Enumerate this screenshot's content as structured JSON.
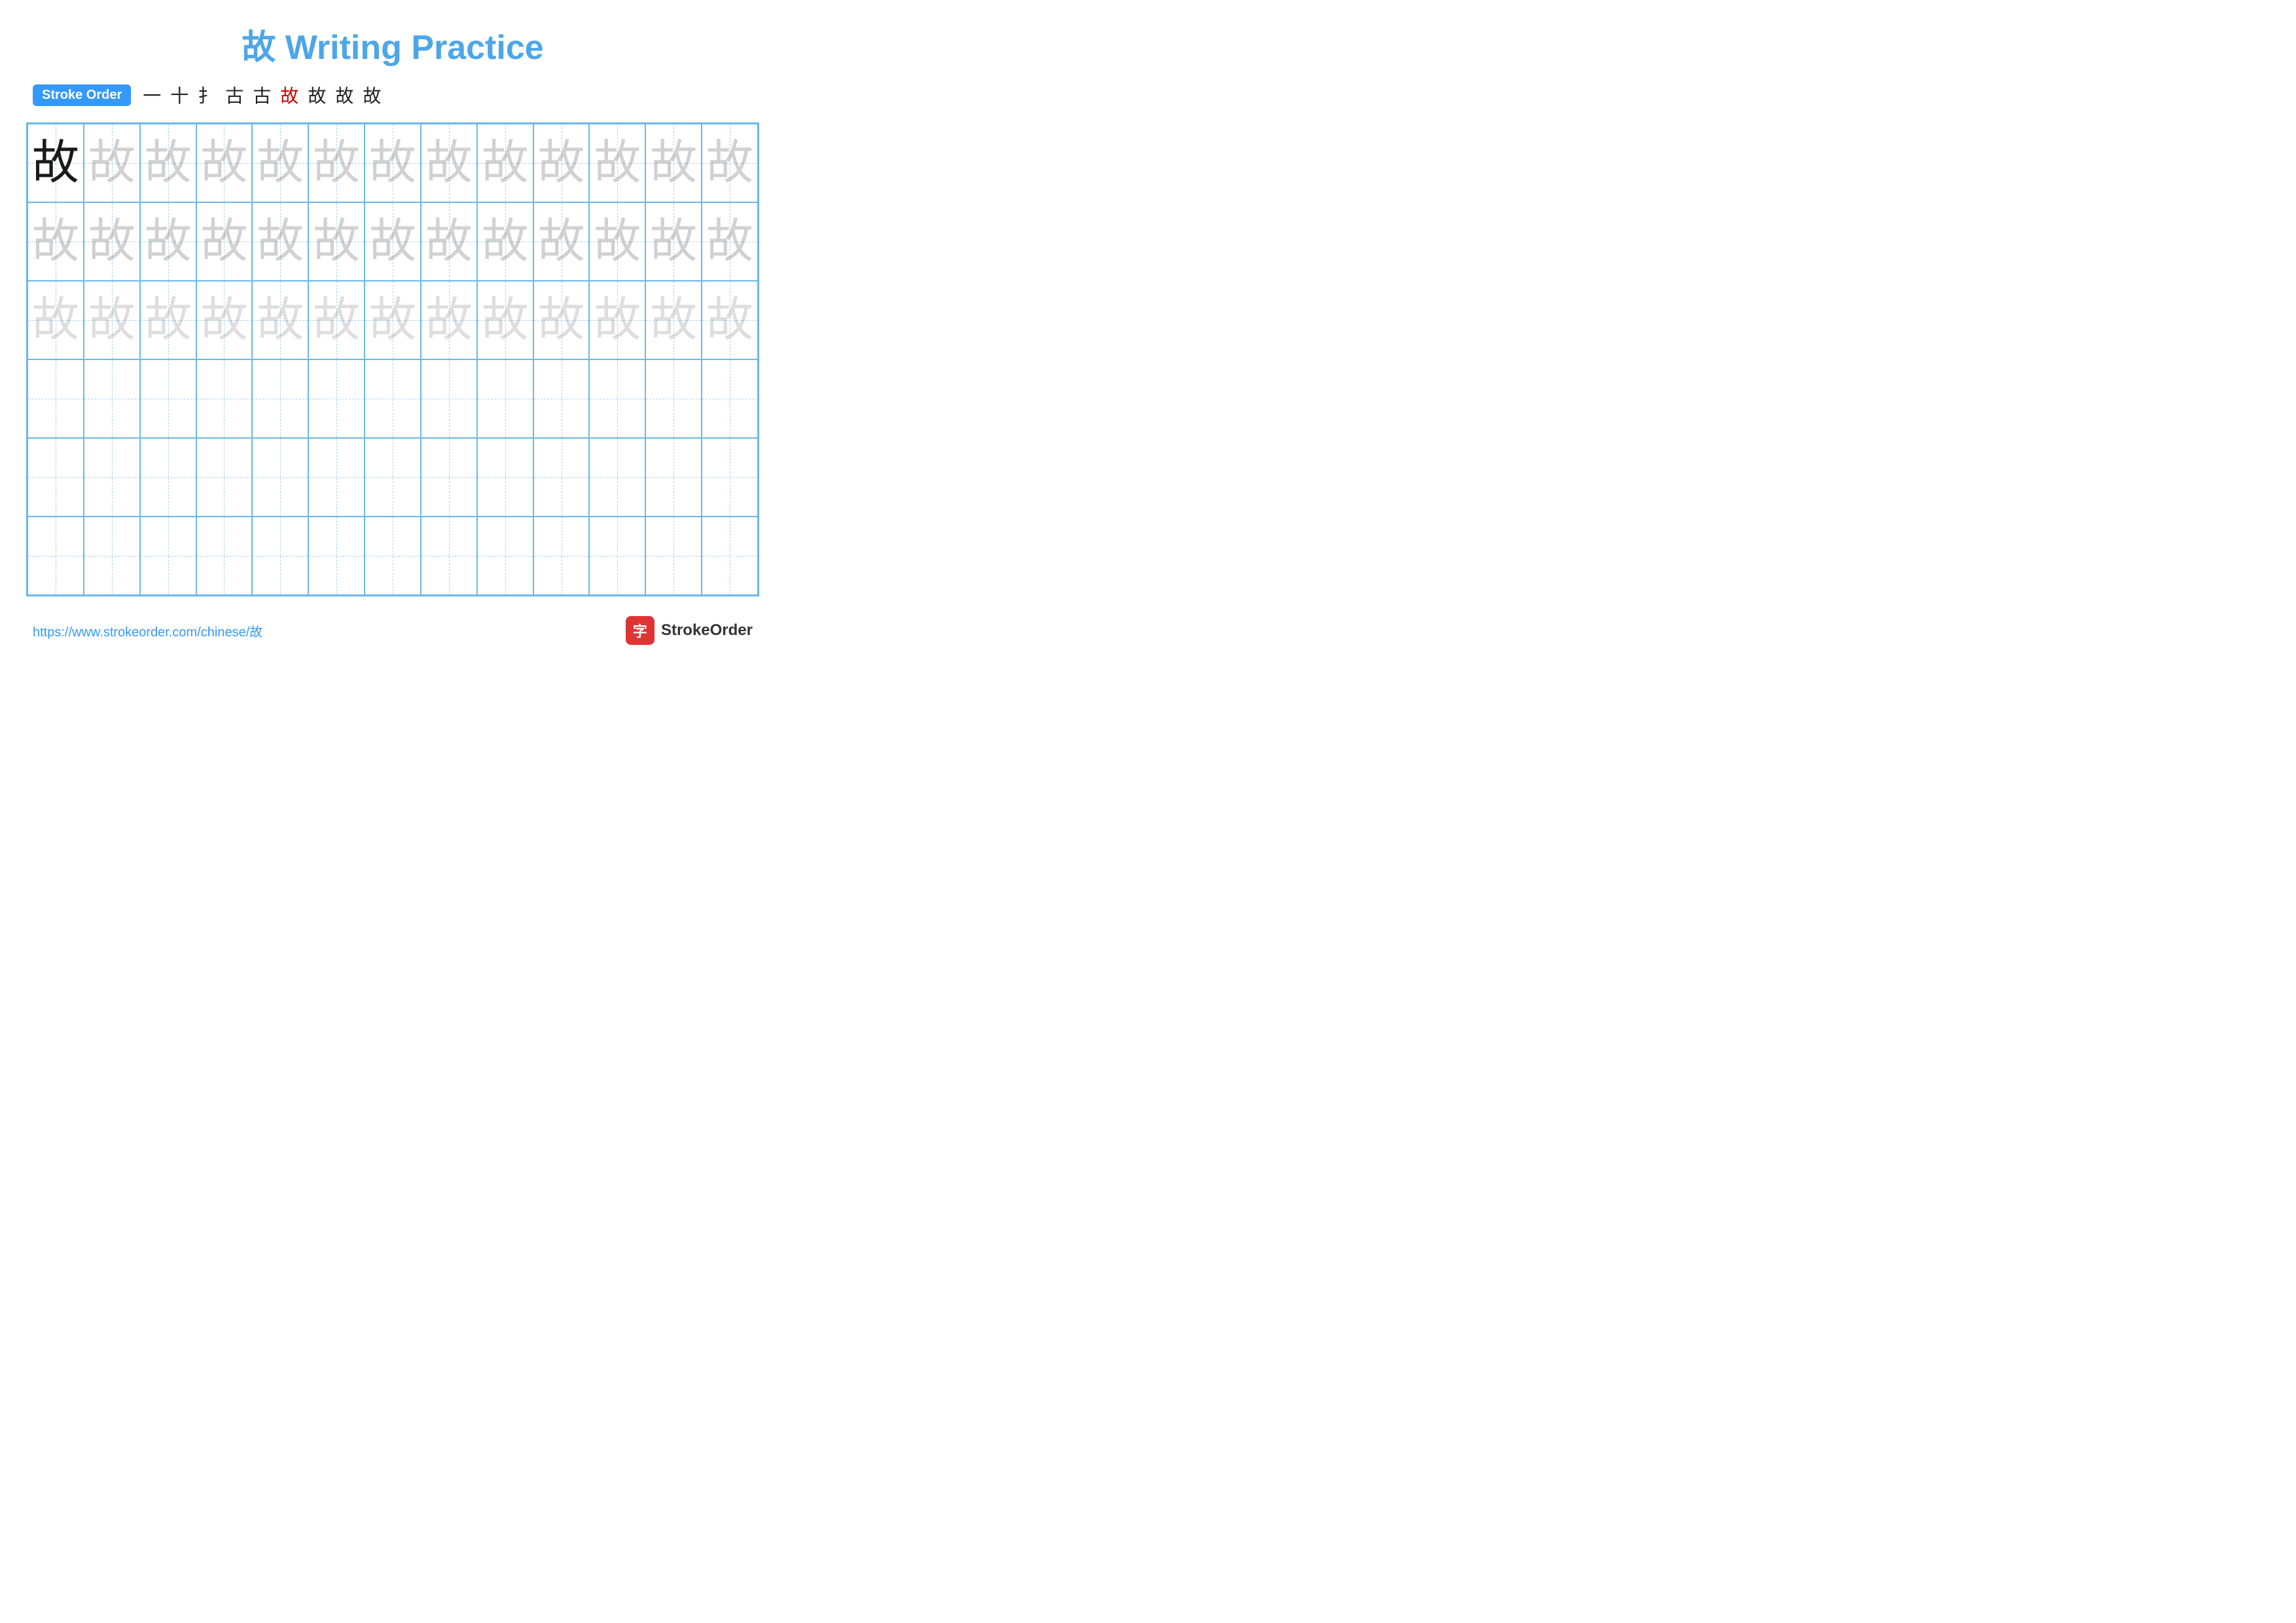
{
  "title": {
    "chinese_char": "故",
    "text": "Writing Practice",
    "full": "故 Writing Practice"
  },
  "stroke_order": {
    "badge_label": "Stroke Order",
    "strokes": [
      "一",
      "十",
      "十",
      "古",
      "古",
      "故",
      "故",
      "故",
      "故"
    ]
  },
  "grid": {
    "rows": 6,
    "cols": 13,
    "character": "故",
    "row_types": [
      "dark",
      "light1",
      "light2",
      "empty",
      "empty",
      "empty"
    ]
  },
  "footer": {
    "url": "https://www.strokeorder.com/chinese/故",
    "logo_char": "字",
    "logo_text": "StrokeOrder"
  }
}
